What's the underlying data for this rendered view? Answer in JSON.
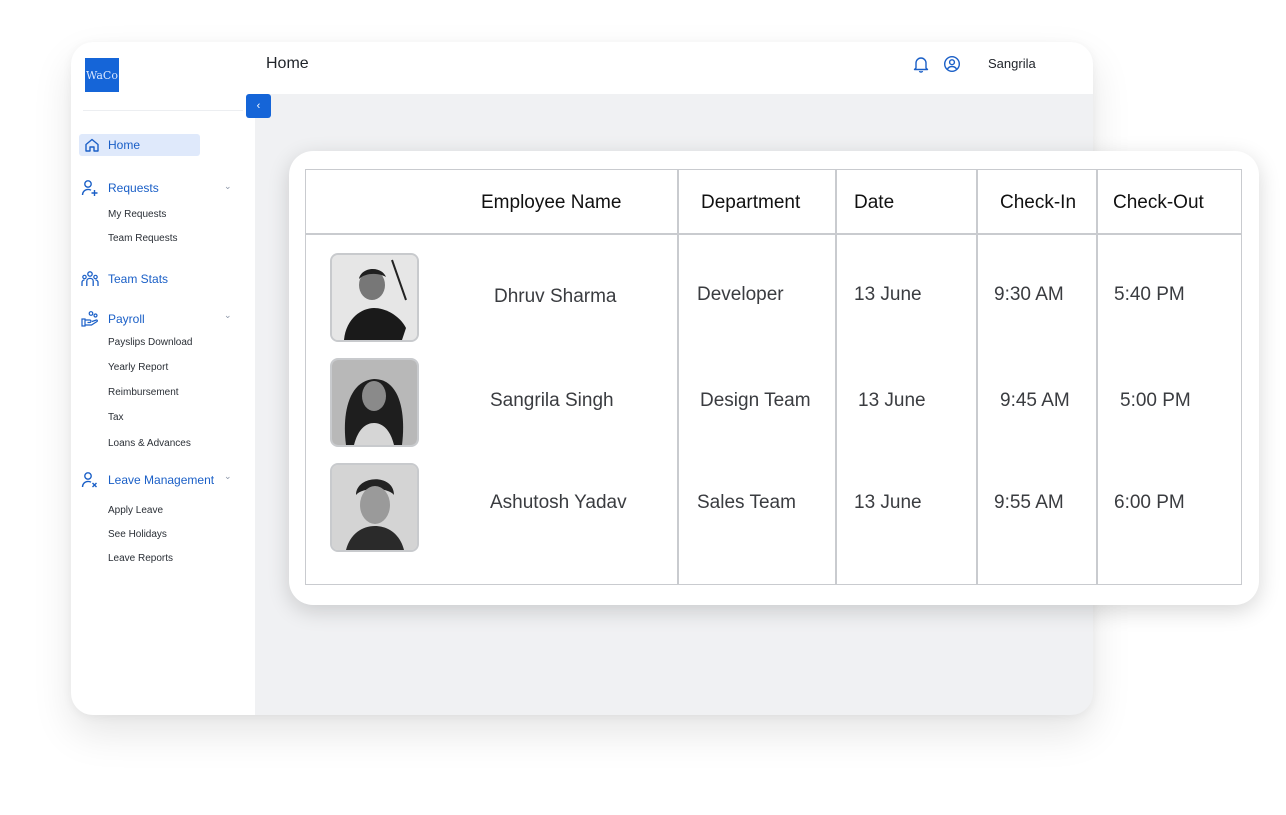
{
  "app": {
    "logo": "WaCo",
    "page_title": "Home",
    "username": "Sangrila"
  },
  "sidebar": {
    "home": "Home",
    "requests": {
      "label": "Requests",
      "items": [
        "My Requests",
        "Team Requests"
      ]
    },
    "team_stats": {
      "label": "Team Stats"
    },
    "payroll": {
      "label": "Payroll",
      "items": [
        "Payslips Download",
        "Yearly Report",
        "Reimbursement",
        "Tax",
        "Loans & Advances"
      ]
    },
    "leave": {
      "label": "Leave Management",
      "items": [
        "Apply Leave",
        "See Holidays",
        "Leave Reports"
      ]
    }
  },
  "table": {
    "columns": [
      "Employee Name",
      "Department",
      "Date",
      "Check-In",
      "Check-Out"
    ],
    "rows": [
      {
        "name": "Dhruv Sharma",
        "department": "Developer",
        "date": "13 June",
        "check_in": "9:30 AM",
        "check_out": "5:40 PM"
      },
      {
        "name": "Sangrila Singh",
        "department": "Design Team",
        "date": "13 June",
        "check_in": "9:45 AM",
        "check_out": "5:00 PM"
      },
      {
        "name": "Ashutosh Yadav",
        "department": "Sales Team",
        "date": "13 June",
        "check_in": "9:55 AM",
        "check_out": "6:00 PM"
      }
    ]
  },
  "icons": {
    "home": "home-icon",
    "requests": "user-plus-icon",
    "team_stats": "team-icon",
    "payroll": "payroll-hand-icon",
    "leave": "user-x-icon",
    "bell": "bell-icon",
    "user": "user-circle-icon",
    "collapse": "chevron-left-icon"
  },
  "colors": {
    "accent": "#1565d8",
    "active_bg": "#dfe9fb",
    "content_bg": "#f0f1f3"
  }
}
